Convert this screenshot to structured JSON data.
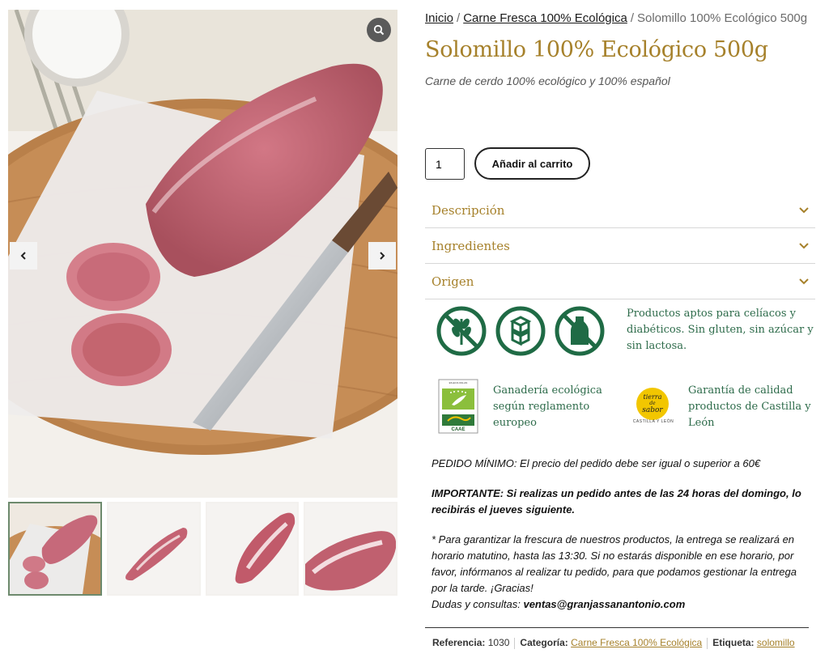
{
  "breadcrumb": {
    "home": "Inicio",
    "category": "Carne Fresca 100% Ecológica",
    "current": "Solomillo 100% Ecológico 500g",
    "separator": "/"
  },
  "product": {
    "title": "Solomillo 100% Ecológico 500g",
    "subtitle": "Carne de cerdo 100% ecológico y 100% español",
    "quantity": "1",
    "add_to_cart": "Añadir al carrito"
  },
  "accordion": [
    {
      "label": "Descripción"
    },
    {
      "label": "Ingredientes"
    },
    {
      "label": "Origen"
    }
  ],
  "badges": {
    "icons": [
      "gluten-free-icon",
      "sugar-free-icon",
      "lactose-free-icon"
    ],
    "text": "Productos aptos para celíacos y diabéticos. Sin gluten, sin azúcar y sin lactosa."
  },
  "certifications": {
    "eco_text": "Ganadería ecológica según reglamento europeo",
    "eco_label": "CAAE",
    "eco_code": "ES-ECO-001-AN",
    "regional_logo_lines": [
      "tierra",
      "de",
      "sabor"
    ],
    "regional_caption": "CASTILLA Y LEÓN",
    "regional_text": "Garantía de calidad productos de Castilla y León"
  },
  "info": {
    "min_order": "PEDIDO MÍNIMO: El precio del pedido debe ser igual o superior a 60€",
    "important": "IMPORTANTE: Si realizas un pedido antes de las 24 horas del domingo, lo recibirás el jueves siguiente.",
    "note": "* Para garantizar la frescura de nuestros productos, la entrega se realizará en horario matutino, hasta las 13:30. Si no estarás disponible en ese horario, por favor, infórmanos al realizar tu pedido, para que podamos gestionar la entrega por la tarde. ¡Gracias!",
    "contact_prefix": "Dudas y consultas:",
    "contact_email": "ventas@granjassanantonio.com"
  },
  "meta": {
    "ref_label": "Referencia:",
    "ref_value": "1030",
    "cat_label": "Categoría:",
    "cat_value": "Carne Fresca 100% Ecológica",
    "tag_label": "Etiqueta:",
    "tag_value": "solomillo"
  },
  "colors": {
    "gold": "#a6812b",
    "green": "#2d6b4a",
    "thumb_border": "#6d8a6d"
  }
}
